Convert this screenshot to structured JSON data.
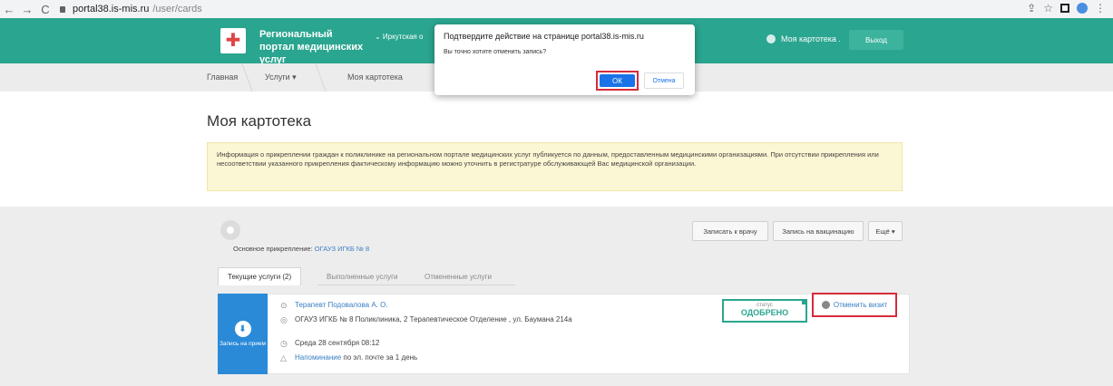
{
  "browser": {
    "back": "←",
    "forward": "→",
    "reload": "C",
    "url_host": "portal38.is-mis.ru",
    "url_path": "/user/cards",
    "share_icon": "share-icon",
    "star": "☆"
  },
  "header": {
    "portal_title": "Региональный портал медицинских услуг",
    "region": "⌄ Иркутская о",
    "my_cards": "Моя картотека .",
    "exit": "Выход",
    "brand_color": "#2aa58f"
  },
  "breadcrumb": {
    "home": "Главная",
    "services": "Услуги ▾",
    "current": "Моя картотека"
  },
  "page": {
    "title": "Моя картотека",
    "info": "Информация о прикреплении граждан к поликлинике на региональном портале медицинских услуг публикуется по данным, предоставленным медицинскими организациями. При отсутствии прикрепления или несоответствии указанного прикрепления фактическому информацию можно уточнить в регистратуре обслуживающей Вас медицинской организации."
  },
  "profile": {
    "attach_label": "Основное прикрепление:",
    "attach_value": "ОГАУЗ ИГКБ № 8",
    "btn_doctor": "Записать к врачу",
    "btn_vaccine": "Запись на вакцинацию",
    "btn_more": "Ещё ▾"
  },
  "tabs": [
    {
      "label": "Текущие услуги (2)"
    },
    {
      "label": "Выполненные услуги"
    },
    {
      "label": "Отмененные услуги"
    }
  ],
  "appointment": {
    "side_label": "Запись на прием",
    "doctor": "Терапевт Подовалова А. О.",
    "place": "ОГАУЗ ИГКБ № 8 Поликлиника, 2 Терапевтическое Отделение , ул. Баумана 214а",
    "datetime": "Среда 28 сентября 08:12",
    "reminder_link": "Напоминание",
    "reminder_rest": " по эл. почте за 1 день",
    "status_label": "статус",
    "status_value": "ОДОБРЕНО",
    "cancel": "Отменить визит"
  },
  "dialog": {
    "title": "Подтвердите действие на странице portal38.is-mis.ru",
    "message": "Вы точно хотите отменить запись?",
    "ok": "ОК",
    "cancel": "Отмена"
  },
  "colors": {
    "accent": "#2aa58f",
    "highlight": "#d62b3b",
    "link": "#3a7fc3"
  }
}
